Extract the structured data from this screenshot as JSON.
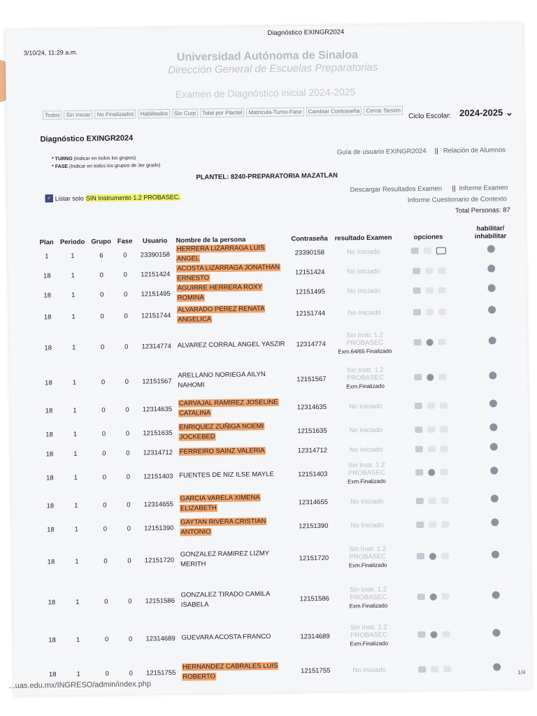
{
  "print_header": {
    "date": "3/10/24, 11:29 a.m.",
    "title": "Diagnóstico EXINGR2024"
  },
  "university": {
    "name": "Universidad Autónoma de Sinaloa",
    "subtitle": "Dirección General de Escuelas Preparatorias",
    "exam_title": "Examen de Diagnóstico inicial 2024-2025"
  },
  "nav": [
    "Todos",
    "Sin Iniciar",
    "No Finalizados",
    "Habilitados",
    "Sin Curp",
    "Total por Plantel",
    "Matricula-Turno-Fase",
    "Cambiar Contraseña",
    "Cerrar Sesión"
  ],
  "ciclo": {
    "label": "Ciclo Escolar:",
    "value": "2024-2025"
  },
  "page_heading": "Diagnóstico EXINGR2024",
  "notes": {
    "turno_label": "* TURNO",
    "turno_text": "(Indicar en todos los grupos)",
    "fase_label": "* FASE",
    "fase_text": "(Indicar en todos los grupos de 3er grado)"
  },
  "links": {
    "guia": "Guía de usuario EXINGR2024",
    "relacion": "Relación de Alumnos",
    "descargar": "Descargar Resultados Examen",
    "informe_examen": "Informe Examen",
    "informe_cuestionario": "Informe Cuestionario de Contexto"
  },
  "separator": "||",
  "plantel": "PLANTEL: 8240-PREPARATORIA MAZATLAN",
  "filter": {
    "prefix": "Listar solo",
    "highlight": "SIN Instrumento 1.2 PROBASEC.",
    "checked": true
  },
  "total": "Total Personas: 87",
  "columns": [
    "Plan",
    "Periodo",
    "Grupo",
    "Fase",
    "Usuario",
    "Nombre de la persona",
    "Contraseña",
    "resultado Examen",
    "opciones",
    "habilitar/ inhabilitar"
  ],
  "rows": [
    {
      "plan": "1",
      "periodo": "1",
      "grupo": "6",
      "fase": "0",
      "usuario": "23390158",
      "nombre": "HERRERA LIZARRAGA LUIS ANGEL",
      "pass": "23390158",
      "res1": "No Iniciado",
      "res2": "",
      "res3": "",
      "highlight": true,
      "mail": true
    },
    {
      "plan": "18",
      "periodo": "1",
      "grupo": "0",
      "fase": "0",
      "usuario": "12151424",
      "nombre": "ACOSTA LIZARRAGA JONATHAN ERNESTO",
      "pass": "12151424",
      "res1": "No Iniciado",
      "res2": "",
      "res3": "",
      "highlight": true
    },
    {
      "plan": "18",
      "periodo": "1",
      "grupo": "0",
      "fase": "0",
      "usuario": "12151495",
      "nombre": "AGUIRRE HERRERA ROXY ROMINA",
      "pass": "12151495",
      "res1": "No Iniciado",
      "res2": "",
      "res3": "",
      "highlight": true
    },
    {
      "plan": "18",
      "periodo": "1",
      "grupo": "0",
      "fase": "0",
      "usuario": "12151744",
      "nombre": "ALVARADO PEREZ RENATA ANGELICA",
      "pass": "12151744",
      "res1": "No Iniciado",
      "res2": "",
      "res3": "",
      "highlight": true
    },
    {
      "plan": "18",
      "periodo": "1",
      "grupo": "0",
      "fase": "0",
      "usuario": "12314774",
      "nombre": "ALVAREZ CORRAL ANGEL YASZIR",
      "pass": "12314774",
      "res1": "Sin Instr. 1.2",
      "res2": "PROBASEC",
      "res3": "Exm.64/65 Finalizado",
      "highlight": false
    },
    {
      "plan": "18",
      "periodo": "1",
      "grupo": "0",
      "fase": "0",
      "usuario": "12151567",
      "nombre": "ARELLANO NORIEGA AILYN NAHOMI",
      "pass": "12151567",
      "res1": "Sin Instr. 1.2",
      "res2": "PROBASEC",
      "res3": "Exm.Finalizado",
      "highlight": false
    },
    {
      "plan": "18",
      "periodo": "1",
      "grupo": "0",
      "fase": "0",
      "usuario": "12314635",
      "nombre": "CARVAJAL RAMIREZ JOSELINE CATALINA",
      "pass": "12314635",
      "res1": "No Iniciado",
      "res2": "",
      "res3": "",
      "highlight": true
    },
    {
      "plan": "18",
      "periodo": "1",
      "grupo": "0",
      "fase": "0",
      "usuario": "12151635",
      "nombre": "ENRIQUEZ ZUÑIGA NOEMI JOCKEBED",
      "pass": "12151635",
      "res1": "No Iniciado",
      "res2": "",
      "res3": "",
      "highlight": true
    },
    {
      "plan": "18",
      "periodo": "1",
      "grupo": "0",
      "fase": "0",
      "usuario": "12314712",
      "nombre": "FERREIRO SAINZ VALERIA",
      "pass": "12314712",
      "res1": "No Iniciado",
      "res2": "",
      "res3": "",
      "highlight": true
    },
    {
      "plan": "18",
      "periodo": "1",
      "grupo": "0",
      "fase": "0",
      "usuario": "12151403",
      "nombre": "FUENTES DE NIZ ILSE MAYLE",
      "pass": "12151403",
      "res1": "Sin Instr. 1.2",
      "res2": "PROBASEC",
      "res3": "Exm.Finalizado",
      "highlight": false
    },
    {
      "plan": "18",
      "periodo": "1",
      "grupo": "0",
      "fase": "0",
      "usuario": "12314655",
      "nombre": "GARCIA VARELA XIMENA ELIZABETH",
      "pass": "12314655",
      "res1": "No Iniciado",
      "res2": "",
      "res3": "",
      "highlight": true
    },
    {
      "plan": "18",
      "periodo": "1",
      "grupo": "0",
      "fase": "0",
      "usuario": "12151390",
      "nombre": "GAYTAN RIVERA CRISTIAN ANTONIO",
      "pass": "12151390",
      "res1": "No Iniciado",
      "res2": "",
      "res3": "",
      "highlight": true
    },
    {
      "plan": "18",
      "periodo": "1",
      "grupo": "0",
      "fase": "0",
      "usuario": "12151720",
      "nombre": "GONZALEZ RAMIREZ LIZMY MERITH",
      "pass": "12151720",
      "res1": "Sin Instr. 1.2",
      "res2": "PROBASEC",
      "res3": "Exm.Finalizado",
      "highlight": false
    },
    {
      "plan": "18",
      "periodo": "1",
      "grupo": "0",
      "fase": "0",
      "usuario": "12151586",
      "nombre": "GONZALEZ TIRADO CAMILA ISABELA",
      "pass": "12151586",
      "res1": "Sin Instr. 1.2",
      "res2": "PROBASEC",
      "res3": "Exm.Finalizado",
      "highlight": false
    },
    {
      "plan": "18",
      "periodo": "1",
      "grupo": "0",
      "fase": "0",
      "usuario": "12314689",
      "nombre": "GUEVARA ACOSTA FRANCO",
      "pass": "12314689",
      "res1": "Sin Instr. 1.2",
      "res2": "PROBASEC",
      "res3": "Exm.Finalizado",
      "highlight": false
    },
    {
      "plan": "18",
      "periodo": "1",
      "grupo": "0",
      "fase": "0",
      "usuario": "12151755",
      "nombre": "HERNANDEZ CABRALES LUIS ROBERTO",
      "pass": "12151755",
      "res1": "No Iniciado",
      "res2": "",
      "res3": "",
      "highlight": true
    }
  ],
  "footer": {
    "url": "...uas.edu.mx/INGRESO/admin/index.php",
    "page": "1/4"
  },
  "colors": {
    "highlight_name": "#f0a46c",
    "highlight_filter": "#eef26a",
    "paper": "#f5f6f8"
  }
}
